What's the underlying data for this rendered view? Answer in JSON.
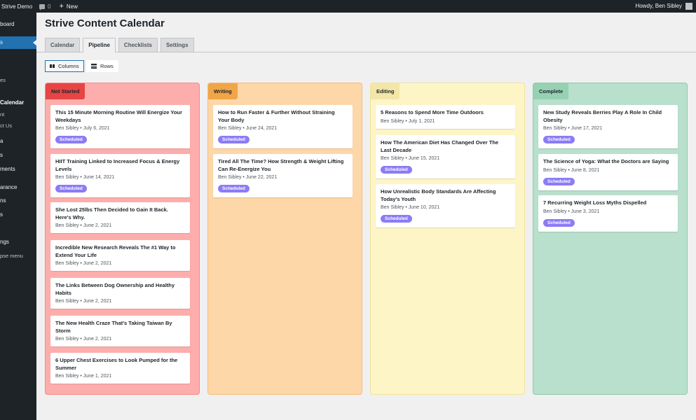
{
  "adminbar": {
    "site": "Strive Demo",
    "comment_count": "0",
    "new_label": "New",
    "howdy": "Howdy, Ben Sibley"
  },
  "sidebar": {
    "items": [
      {
        "label": "board"
      },
      {
        "label": "s"
      },
      {
        "label": "es"
      },
      {
        "label": "Calendar"
      },
      {
        "label": "nt"
      },
      {
        "label": "ct Us"
      },
      {
        "label": "a"
      },
      {
        "label": "s"
      },
      {
        "label": "ments"
      },
      {
        "label": "arance"
      },
      {
        "label": "ns"
      },
      {
        "label": "s"
      },
      {
        "label": "ngs"
      },
      {
        "label": "pse menu"
      }
    ]
  },
  "page": {
    "title": "Strive Content Calendar"
  },
  "tabs": [
    {
      "label": "Calendar"
    },
    {
      "label": "Pipeline"
    },
    {
      "label": "Checklists"
    },
    {
      "label": "Settings"
    }
  ],
  "view_toggle": {
    "columns": "Columns",
    "rows": "Rows"
  },
  "colors": {
    "accent": "#2271b1",
    "badge": "#8b7cf6"
  },
  "columns": [
    {
      "name": "Not Started",
      "cards": [
        {
          "title": "This 15 Minute Morning Routine Will Energize Your Weekdays",
          "meta": "Ben Sibley • July 6, 2021",
          "badge": "Scheduled"
        },
        {
          "title": "HIIT Training Linked to Increased Focus & Energy Levels",
          "meta": "Ben Sibley • June 14, 2021",
          "badge": "Scheduled"
        },
        {
          "title": "She Lost 25lbs Then Decided to Gain It Back. Here's Why.",
          "meta": "Ben Sibley • June 2, 2021"
        },
        {
          "title": "Incredible New Research Reveals The #1 Way to Extend Your Life",
          "meta": "Ben Sibley • June 2, 2021"
        },
        {
          "title": "The Links Between Dog Ownership and Healthy Habits",
          "meta": "Ben Sibley • June 2, 2021"
        },
        {
          "title": "The New Health Craze That's Taking Taiwan By Storm",
          "meta": "Ben Sibley • June 2, 2021"
        },
        {
          "title": "6 Upper Chest Exercises to Look Pumped for the Summer",
          "meta": "Ben Sibley • June 1, 2021"
        }
      ]
    },
    {
      "name": "Writing",
      "cards": [
        {
          "title": "How to Run Faster & Further Without Straining Your Body",
          "meta": "Ben Sibley • June 24, 2021",
          "badge": "Scheduled"
        },
        {
          "title": "Tired All The Time? How Strength & Weight Lifting Can Re-Energize You",
          "meta": "Ben Sibley • June 22, 2021",
          "badge": "Scheduled"
        }
      ]
    },
    {
      "name": "Editing",
      "cards": [
        {
          "title": "5 Reasons to Spend More Time Outdoors",
          "meta": "Ben Sibley • July 1, 2021"
        },
        {
          "title": "How The American Diet Has Changed Over The Last Decade",
          "meta": "Ben Sibley • June 15, 2021",
          "badge": "Scheduled"
        },
        {
          "title": "How Unrealistic Body Standards Are Affecting Today's Youth",
          "meta": "Ben Sibley • June 10, 2021",
          "badge": "Scheduled"
        }
      ]
    },
    {
      "name": "Complete",
      "cards": [
        {
          "title": "New Study Reveals Berries Play A Role In Child Obesity",
          "meta": "Ben Sibley • June 17, 2021",
          "badge": "Scheduled"
        },
        {
          "title": "The Science of Yoga: What the Doctors are Saying",
          "meta": "Ben Sibley • June 8, 2021",
          "badge": "Scheduled"
        },
        {
          "title": "7 Recurring Weight Loss Myths Dispelled",
          "meta": "Ben Sibley • June 3, 2021",
          "badge": "Scheduled"
        }
      ]
    }
  ]
}
